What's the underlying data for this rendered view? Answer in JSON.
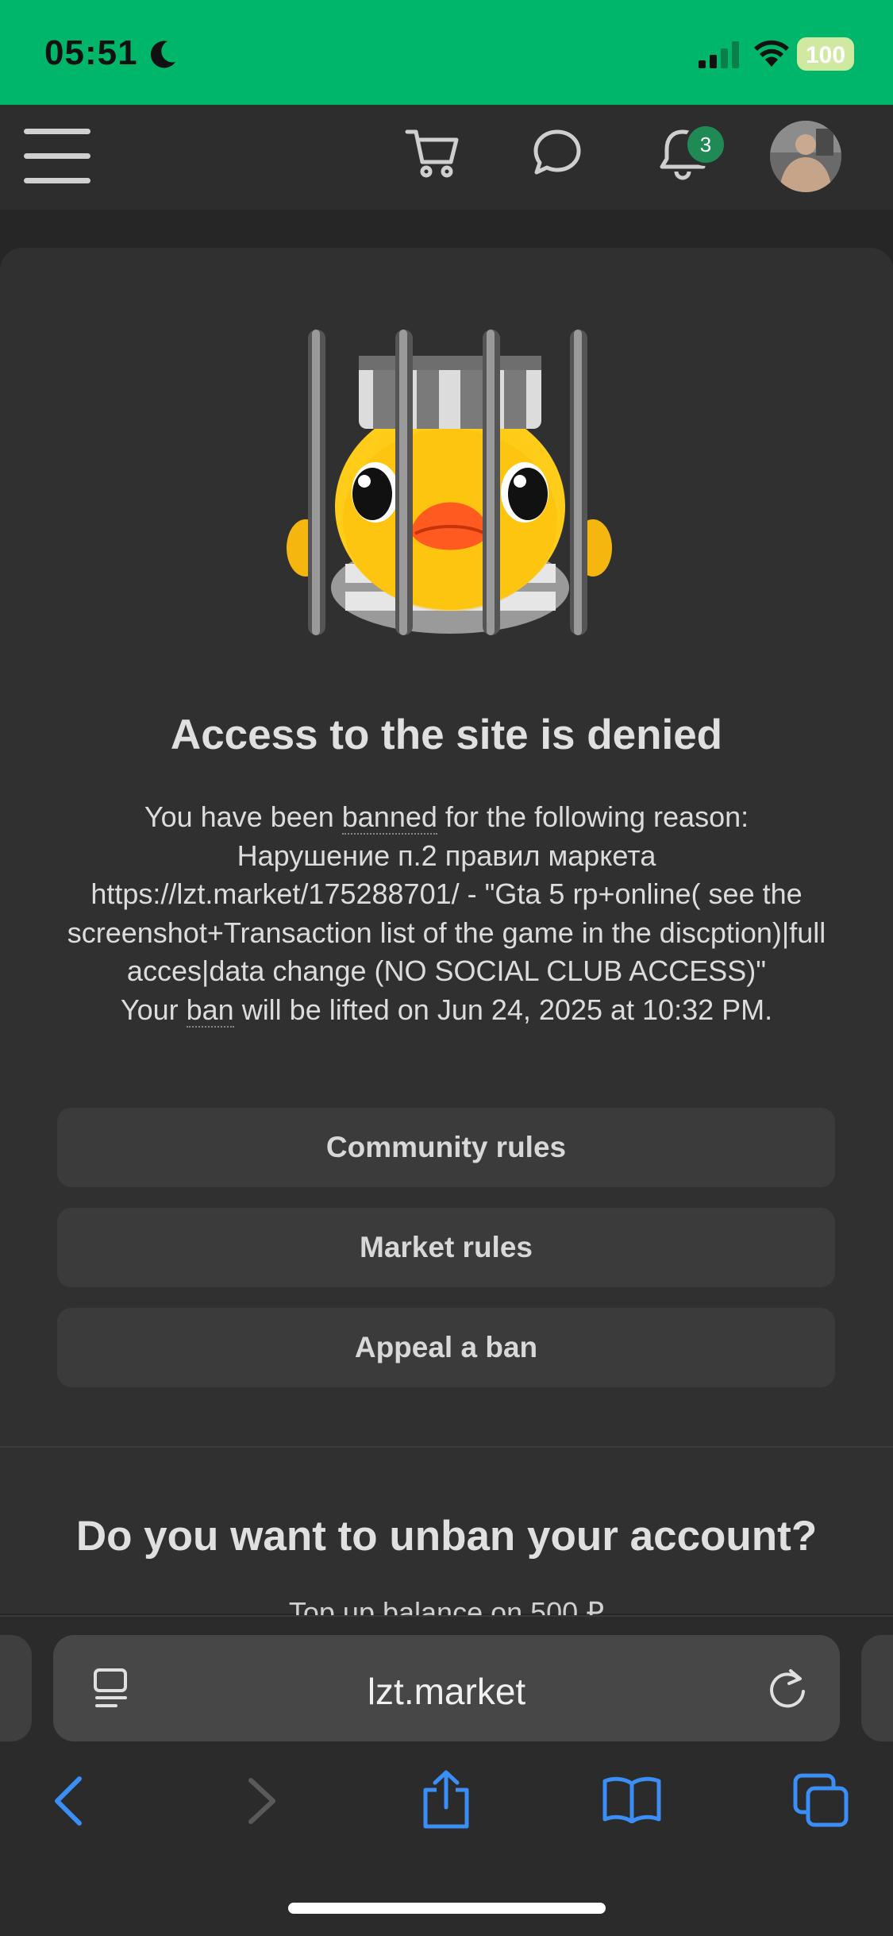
{
  "status_bar": {
    "time": "05:51",
    "battery": "100"
  },
  "nav": {
    "notification_count": "3"
  },
  "ban": {
    "title": "Access to the site is denied",
    "reason_prefix": "You have been ",
    "reason_link": "banned",
    "reason_suffix": " for the following reason:",
    "reason_line2": "Нарушение п.2 правил маркета",
    "reason_line3": "https://lzt.market/175288701/ - \"Gta 5 rp+online( see the screenshot+Transaction list of the game in the discption)|full acces|data change (NO SOCIAL CLUB ACCESS)\"",
    "lift_prefix": "Your ",
    "lift_link": "ban",
    "lift_suffix": " will be lifted on Jun 24, 2025 at 10:32 PM."
  },
  "buttons": {
    "community_rules": "Community rules",
    "market_rules": "Market rules",
    "appeal": "Appeal a ban"
  },
  "unban": {
    "title": "Do you want to unban your account?",
    "topup_text": "Top up balance on 500 ₽"
  },
  "browser": {
    "url": "lzt.market"
  },
  "colors": {
    "status_bar": "#00b66b",
    "toolbar_icons": "#3a8ef6",
    "badge": "#1f8a55"
  }
}
